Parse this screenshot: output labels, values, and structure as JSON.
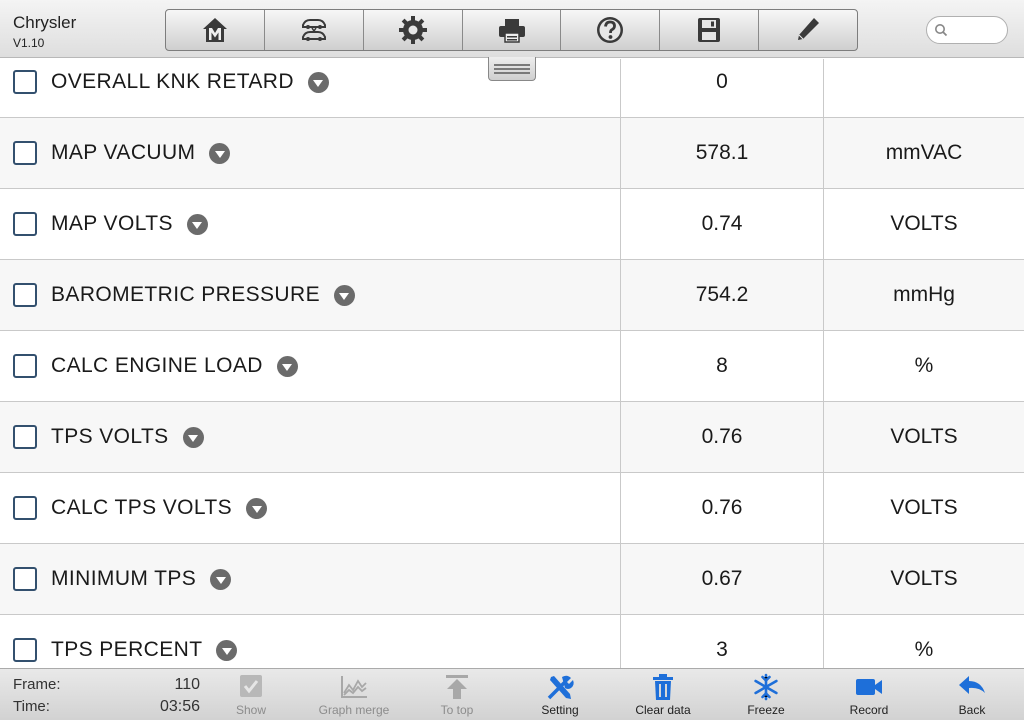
{
  "header": {
    "title": "Chrysler",
    "version": "V1.10"
  },
  "toolbar": {
    "buttons": [
      {
        "name": "home-icon"
      },
      {
        "name": "vehicle-swap-icon"
      },
      {
        "name": "settings-gear-icon"
      },
      {
        "name": "printer-icon"
      },
      {
        "name": "help-icon"
      },
      {
        "name": "save-icon"
      },
      {
        "name": "edit-pen-icon"
      }
    ]
  },
  "search": {
    "placeholder": ""
  },
  "rows": [
    {
      "name": "OVERALL KNK RETARD",
      "value": "0",
      "unit": ""
    },
    {
      "name": "MAP VACUUM",
      "value": "578.1",
      "unit": "mmVAC"
    },
    {
      "name": "MAP VOLTS",
      "value": "0.74",
      "unit": "VOLTS"
    },
    {
      "name": "BAROMETRIC PRESSURE",
      "value": "754.2",
      "unit": "mmHg"
    },
    {
      "name": "CALC ENGINE LOAD",
      "value": "8",
      "unit": "%"
    },
    {
      "name": "TPS VOLTS",
      "value": "0.76",
      "unit": "VOLTS"
    },
    {
      "name": "CALC TPS VOLTS",
      "value": "0.76",
      "unit": "VOLTS"
    },
    {
      "name": "MINIMUM TPS",
      "value": "0.67",
      "unit": "VOLTS"
    },
    {
      "name": "TPS PERCENT",
      "value": "3",
      "unit": "%"
    }
  ],
  "footer": {
    "frame_label": "Frame:",
    "frame_value": "110",
    "time_label": "Time:",
    "time_value": "03:56",
    "show": "Show",
    "graph_merge": "Graph merge",
    "to_top": "To top",
    "setting": "Setting",
    "clear_data": "Clear data",
    "freeze": "Freeze",
    "record": "Record",
    "back": "Back"
  },
  "colors": {
    "accent": "#1e6fd9",
    "disabled": "#a8a8a8"
  }
}
